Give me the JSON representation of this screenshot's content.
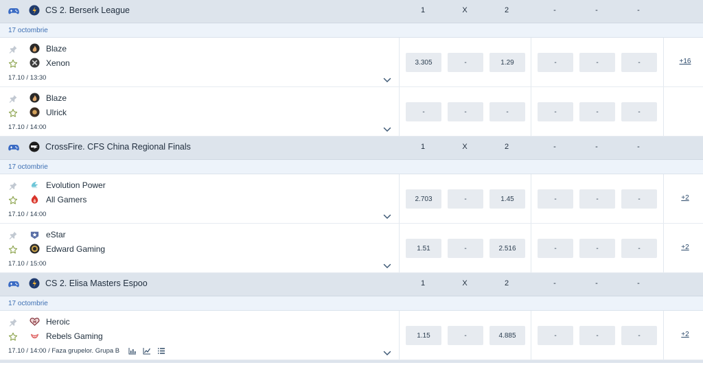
{
  "colors": {
    "league_bg": "#dde4ec",
    "date_bg": "#edf3fa",
    "date_text": "#3d6fb3",
    "odd_bg": "#e7ebf0",
    "star_outline": "#8aa24a",
    "gamepad": "#3a6bc4"
  },
  "leagues": [
    {
      "name": "CS 2. Berserk League",
      "icon": "cs2-logo-icon",
      "headers": [
        "1",
        "X",
        "2",
        "-",
        "-",
        "-"
      ],
      "date": "17 octombrie",
      "matches": [
        {
          "team1": "Blaze",
          "team1_icon": "blaze-logo-icon",
          "team2": "Xenon",
          "team2_icon": "xenon-logo-icon",
          "time": "17.10 / 13:30",
          "odds": [
            "3.305",
            "-",
            "1.29",
            "-",
            "-",
            "-"
          ],
          "more": "+16"
        },
        {
          "team1": "Blaze",
          "team1_icon": "blaze-logo-icon",
          "team2": "Ulrick",
          "team2_icon": "ulrick-logo-icon",
          "time": "17.10 / 14:00",
          "odds": [
            "-",
            "-",
            "-",
            "-",
            "-",
            "-"
          ],
          "more": ""
        }
      ]
    },
    {
      "name": "CrossFire. CFS China Regional Finals",
      "icon": "crossfire-logo-icon",
      "headers": [
        "1",
        "X",
        "2",
        "-",
        "-",
        "-"
      ],
      "date": "17 octombrie",
      "matches": [
        {
          "team1": "Evolution Power",
          "team1_icon": "evolution-power-logo-icon",
          "team2": "All Gamers",
          "team2_icon": "all-gamers-logo-icon",
          "time": "17.10 / 14:00",
          "odds": [
            "2.703",
            "-",
            "1.45",
            "-",
            "-",
            "-"
          ],
          "more": "+2"
        },
        {
          "team1": "eStar",
          "team1_icon": "estar-logo-icon",
          "team2": "Edward Gaming",
          "team2_icon": "edward-gaming-logo-icon",
          "time": "17.10 / 15:00",
          "odds": [
            "1.51",
            "-",
            "2.516",
            "-",
            "-",
            "-"
          ],
          "more": "+2"
        }
      ]
    },
    {
      "name": "CS 2. Elisa Masters Espoo",
      "icon": "cs2-logo-icon",
      "headers": [
        "1",
        "X",
        "2",
        "-",
        "-",
        "-"
      ],
      "date": "17 octombrie",
      "matches": [
        {
          "team1": "Heroic",
          "team1_icon": "heroic-logo-icon",
          "team2": "Rebels Gaming",
          "team2_icon": "rebels-gaming-logo-icon",
          "time": "17.10 / 14:00 / Faza grupelor. Grupa B",
          "odds": [
            "1.15",
            "-",
            "4.885",
            "-",
            "-",
            "-"
          ],
          "more": "+2",
          "stat_icons": [
            "bar-chart-icon",
            "line-chart-icon",
            "list-icon"
          ]
        }
      ]
    }
  ]
}
